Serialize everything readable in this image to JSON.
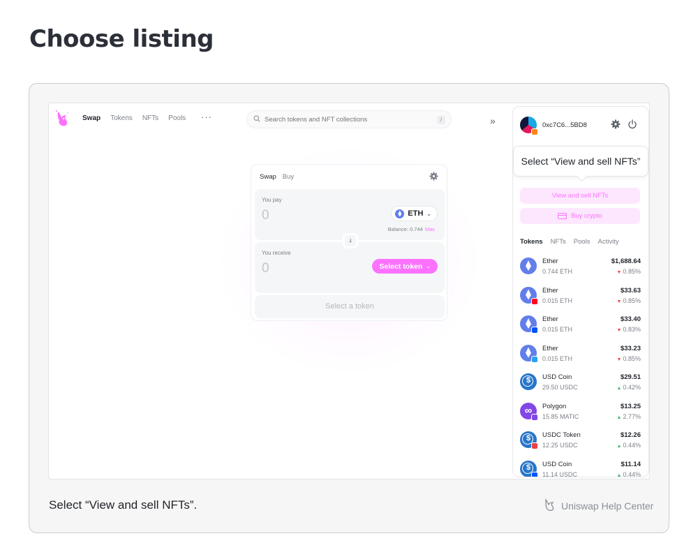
{
  "page": {
    "heading": "Choose listing",
    "caption": "Select “View and sell NFTs”.",
    "help_center": "Uniswap Help Center"
  },
  "nav": {
    "links": [
      "Swap",
      "Tokens",
      "NFTs",
      "Pools"
    ],
    "more": "···",
    "search_placeholder": "Search tokens and NFT collections",
    "search_shortcut": "/",
    "collapse": "»"
  },
  "swap": {
    "tabs": [
      "Swap",
      "Buy"
    ],
    "pay_label": "You pay",
    "pay_amount": "0",
    "pay_token": "ETH",
    "balance_label": "Balance: 0.744",
    "max_label": "Max",
    "receive_label": "You receive",
    "receive_amount": "0",
    "select_token_label": "Select token",
    "submit_label": "Select a token"
  },
  "account": {
    "address": "0xc7C6...5BD8"
  },
  "tooltip": "Select “View and sell NFTs”",
  "panel": {
    "view_sell_nfts": "View and sell NFTs",
    "buy_crypto": "Buy crypto",
    "tabs": [
      "Tokens",
      "NFTs",
      "Pools",
      "Activity"
    ]
  },
  "tokens": [
    {
      "name": "Ether",
      "balance": "0.744 ETH",
      "value": "$1,688.64",
      "change": "0.85%",
      "direction": "down",
      "icon": "eth",
      "chain": ""
    },
    {
      "name": "Ether",
      "balance": "0.015 ETH",
      "value": "$33.63",
      "change": "0.85%",
      "direction": "down",
      "icon": "eth",
      "chain": "optimism"
    },
    {
      "name": "Ether",
      "balance": "0.015 ETH",
      "value": "$33.40",
      "change": "0.83%",
      "direction": "down",
      "icon": "eth",
      "chain": "base"
    },
    {
      "name": "Ether",
      "balance": "0.015 ETH",
      "value": "$33.23",
      "change": "0.85%",
      "direction": "down",
      "icon": "eth",
      "chain": "arbitrum"
    },
    {
      "name": "USD Coin",
      "balance": "29.50 USDC",
      "value": "$29.51",
      "change": "0.42%",
      "direction": "up",
      "icon": "usdc",
      "chain": ""
    },
    {
      "name": "Polygon",
      "balance": "15.85 MATIC",
      "value": "$13.25",
      "change": "2.77%",
      "direction": "up",
      "icon": "matic",
      "chain": "polygon"
    },
    {
      "name": "USDC Token",
      "balance": "12.25 USDC",
      "value": "$12.26",
      "change": "0.44%",
      "direction": "up",
      "icon": "usdc",
      "chain": "avalanche"
    },
    {
      "name": "USD Coin",
      "balance": "11.14 USDC",
      "value": "$11.14",
      "change": "0.44%",
      "direction": "up",
      "icon": "usdc",
      "chain": "base"
    }
  ],
  "colors": {
    "accent": "#fc72ff",
    "accent_soft": "#fde7fe",
    "down": "#fd4040",
    "up": "#40b66b",
    "optimism": "#ff0420",
    "base": "#0052ff",
    "arbitrum": "#28a0f0",
    "polygon": "#8247e5",
    "avalanche": "#e84142"
  }
}
